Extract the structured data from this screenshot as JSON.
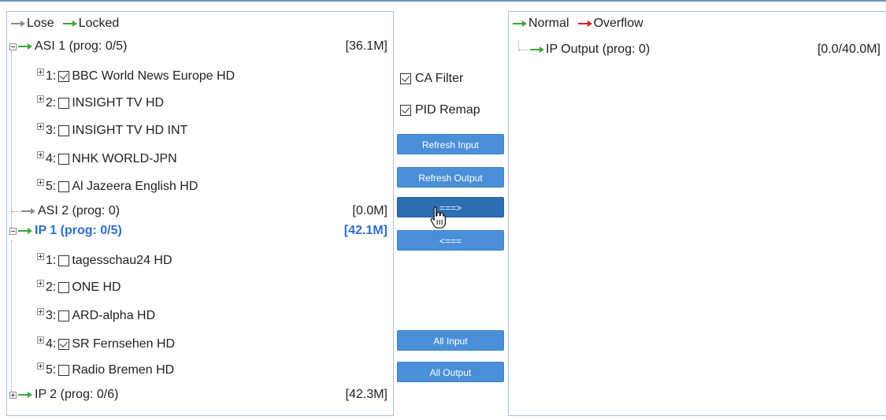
{
  "left_panel": {
    "legend": {
      "lose": "Lose",
      "locked": "Locked"
    },
    "groups": [
      {
        "label": "ASI 1 (prog: 0/5)",
        "rate": "[36.1M]",
        "children": [
          {
            "num": "1:",
            "name": "BBC World News Europe HD",
            "checked": true
          },
          {
            "num": "2:",
            "name": "INSIGHT TV HD",
            "checked": false
          },
          {
            "num": "3:",
            "name": "INSIGHT TV HD INT",
            "checked": false
          },
          {
            "num": "4:",
            "name": "NHK WORLD-JPN",
            "checked": false
          },
          {
            "num": "5:",
            "name": "Al Jazeera English HD",
            "checked": false
          }
        ]
      },
      {
        "label": "ASI 2 (prog: 0)",
        "rate": "[0.0M]"
      },
      {
        "label": "IP 1 (prog: 0/5)",
        "rate": "[42.1M]",
        "children": [
          {
            "num": "1:",
            "name": "tagesschau24 HD",
            "checked": false
          },
          {
            "num": "2:",
            "name": "ONE HD",
            "checked": false
          },
          {
            "num": "3:",
            "name": "ARD-alpha HD",
            "checked": false
          },
          {
            "num": "4:",
            "name": "SR Fernsehen HD",
            "checked": true
          },
          {
            "num": "5:",
            "name": "Radio Bremen HD",
            "checked": false
          }
        ]
      },
      {
        "label": "IP 2 (prog: 0/6)",
        "rate": "[42.3M]"
      }
    ]
  },
  "middle": {
    "ca_filter": "CA Filter",
    "pid_remap": "PID Remap",
    "refresh_input": "Refresh Input",
    "refresh_output": "Refresh Output",
    "move_right": "===>",
    "move_left": "<===",
    "all_input": "All Input",
    "all_output": "All Output"
  },
  "right_panel": {
    "legend": {
      "normal": "Normal",
      "overflow": "Overflow"
    },
    "output": {
      "label": "IP Output (prog: 0)",
      "rate": "[0.0/40.0M]"
    }
  },
  "colors": {
    "green_arrow": "#3aaa35",
    "red_arrow": "#d42020",
    "active_text": "#2a6fcc",
    "button": "#4a90d9"
  },
  "icons": {
    "lose": "gray-arrow-icon",
    "locked": "green-arrow-icon",
    "normal": "green-arrow-icon",
    "overflow": "red-arrow-icon",
    "expander_plus": "plus-icon",
    "expander_minus": "minus-icon",
    "cursor": "hand-pointer-icon"
  }
}
